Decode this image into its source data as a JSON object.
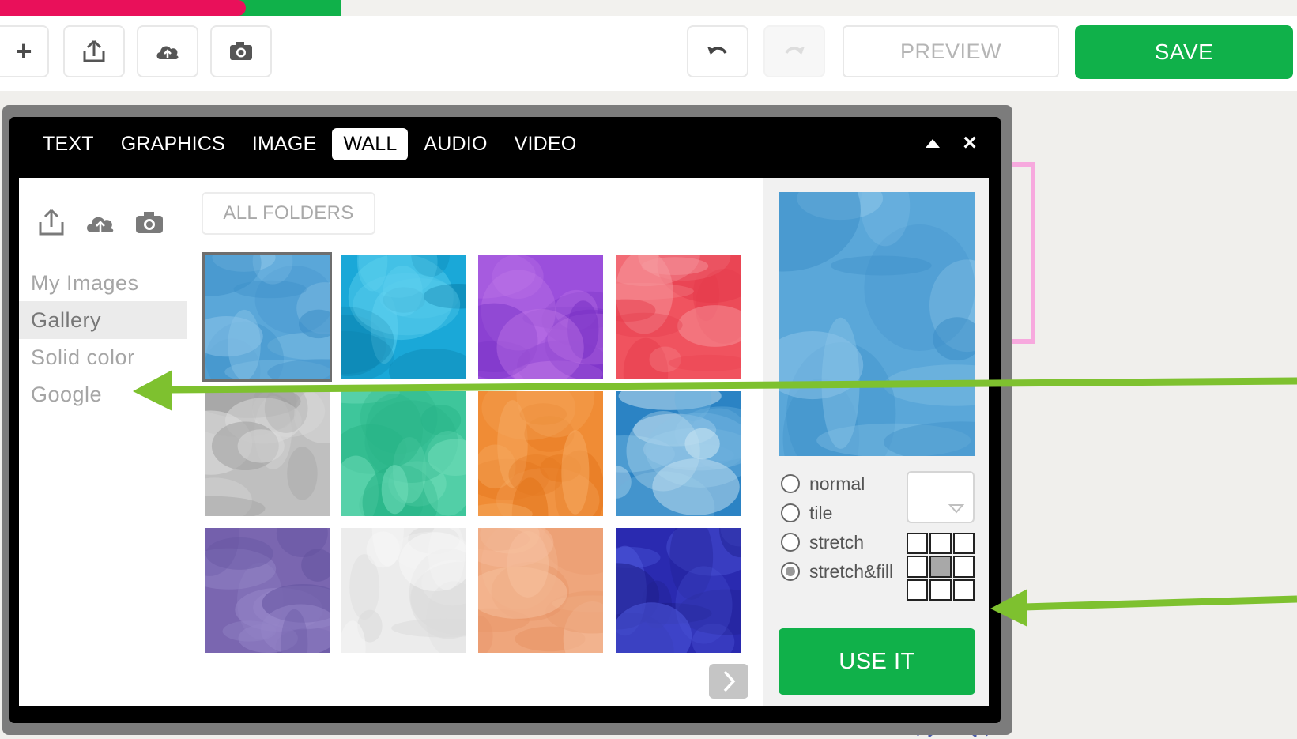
{
  "progress": {
    "value_fraction": 0.72
  },
  "toolbar": {
    "add_icon": "plus-icon",
    "upload_icon": "upload-icon",
    "cloud_icon": "cloud-upload-icon",
    "camera_icon": "camera-icon",
    "undo_icon": "undo-icon",
    "redo_icon": "redo-icon",
    "plus_glyph": "+",
    "preview_label": "PREVIEW",
    "save_label": "SAVE"
  },
  "dialog": {
    "tabs": [
      {
        "label": "TEXT",
        "active": false
      },
      {
        "label": "GRAPHICS",
        "active": false
      },
      {
        "label": "IMAGE",
        "active": false
      },
      {
        "label": "WALL",
        "active": true
      },
      {
        "label": "AUDIO",
        "active": false
      },
      {
        "label": "VIDEO",
        "active": false
      }
    ],
    "collapse_icon": "triangle-up-icon",
    "close_glyph": "×"
  },
  "sources": {
    "icons": [
      "upload-icon",
      "cloud-upload-icon",
      "camera-icon"
    ],
    "items": [
      {
        "label": "My Images",
        "active": false
      },
      {
        "label": "Gallery",
        "active": true
      },
      {
        "label": "Solid color",
        "active": false
      },
      {
        "label": "Google",
        "active": false
      }
    ]
  },
  "gallery": {
    "folder_button_label": "ALL FOLDERS",
    "thumbnails": [
      {
        "name": "blue-watercolor",
        "colors": [
          "#5aa7d9",
          "#3d8fc8",
          "#8cc4e8"
        ],
        "selected": true
      },
      {
        "name": "teal-marble",
        "colors": [
          "#1aa8d8",
          "#0b7fa9",
          "#5fd1ef"
        ],
        "selected": false
      },
      {
        "name": "purple-watercolor",
        "colors": [
          "#9b4fdc",
          "#7a32c6",
          "#c27ae8"
        ],
        "selected": false
      },
      {
        "name": "red-watercolor",
        "colors": [
          "#f0535f",
          "#e63a4b",
          "#f79aa0"
        ],
        "selected": false
      },
      {
        "name": "grey-marble",
        "colors": [
          "#bfbfbf",
          "#9e9e9e",
          "#dcdcdc"
        ],
        "selected": false
      },
      {
        "name": "green-watercolor",
        "colors": [
          "#3ec69b",
          "#27b386",
          "#6fdcb8"
        ],
        "selected": false
      },
      {
        "name": "orange-watercolor",
        "colors": [
          "#f08c35",
          "#e5771d",
          "#f5aa62"
        ],
        "selected": false
      },
      {
        "name": "blue-wash",
        "colors": [
          "#2b83c4",
          "#6fb3df",
          "#c6e2f2"
        ],
        "selected": false
      },
      {
        "name": "violet-stripes",
        "colors": [
          "#7a66b0",
          "#6453a0",
          "#9585c8"
        ],
        "selected": false
      },
      {
        "name": "white-paper",
        "colors": [
          "#ececec",
          "#dadada",
          "#f6f6f6"
        ],
        "selected": false
      },
      {
        "name": "peach-paper",
        "colors": [
          "#efa67c",
          "#e79466",
          "#f5be9c"
        ],
        "selected": false
      },
      {
        "name": "navy-confetti",
        "colors": [
          "#2a2ab0",
          "#1f1f8e",
          "#4b55d8"
        ],
        "selected": false
      }
    ],
    "next_icon": "chevron-right-icon"
  },
  "preview": {
    "image_colors": [
      "#5aa7d9",
      "#3d8fc8",
      "#8cc4e8"
    ],
    "modes": [
      {
        "label": "normal",
        "checked": false
      },
      {
        "label": "tile",
        "checked": false
      },
      {
        "label": "stretch",
        "checked": false
      },
      {
        "label": "stretch&fill",
        "checked": true
      }
    ],
    "swatch_icon": "triangle-down-icon",
    "alignment_cells_active": [
      4
    ],
    "use_it_label": "USE IT"
  },
  "annotations": {
    "arrow_color": "#7ec12f"
  },
  "colors": {
    "brand_green": "#10b14a",
    "progress_pink": "#e9105a"
  }
}
